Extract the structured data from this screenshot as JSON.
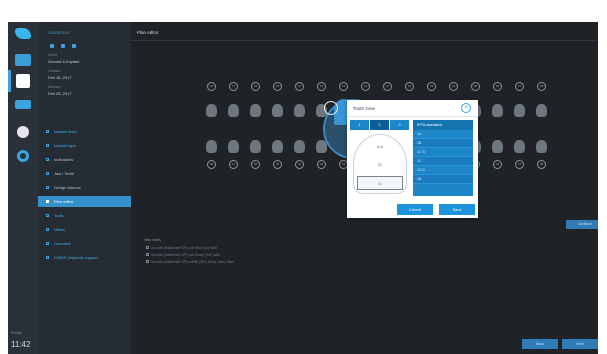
{
  "rail": {
    "clock_label": "Friday",
    "clock_time": "11:42"
  },
  "sidebar": {
    "header": "CLIENTELE",
    "small1": "Client",
    "line1": "Ground & Implant",
    "small2": "Created",
    "line2": "Feb 16, 2017",
    "small3": "Delivery",
    "line3": "Feb 28, 2017",
    "items": [
      {
        "label": "Implant level",
        "style": "blue"
      },
      {
        "label": "Implant type",
        "style": "blue"
      },
      {
        "label": "Indications",
        "style": "normal"
      },
      {
        "label": "Jaw / Teeth",
        "style": "normal"
      },
      {
        "label": "Design interval",
        "style": "normal"
      },
      {
        "label": "Plan editor",
        "style": "active"
      },
      {
        "label": "Tools",
        "style": "blue"
      },
      {
        "label": "Offset",
        "style": "blue"
      },
      {
        "label": "Overview",
        "style": "blue"
      },
      {
        "label": "SINCE (Implant) support",
        "style": "blue"
      }
    ]
  },
  "main": {
    "title": "Plan editor",
    "side_button": "Continue",
    "notes_title": "Help notes",
    "notes": [
      "Smooth (flatten/set SP) soft Slice (SI) Wall",
      "Smooth (flatten/set SP) soft Sharp (SH) Wall",
      "Smooth (flatten/set SP) soft/fill (SIF) Deep, Max) Wall"
    ],
    "upper_numbers": [
      "18",
      "17",
      "16",
      "15",
      "14",
      "13",
      "12",
      "11",
      "21",
      "22",
      "23",
      "24",
      "25",
      "26",
      "27",
      "28"
    ],
    "lower_numbers": [
      "48",
      "47",
      "46",
      "45",
      "44",
      "43",
      "42",
      "41",
      "31",
      "32",
      "33",
      "34",
      "35",
      "36",
      "37",
      "38"
    ],
    "bottom_back": "Back",
    "bottom_next": "Next"
  },
  "modal": {
    "title": "Tooth zone",
    "tabs": [
      "1",
      "2",
      "3"
    ],
    "zones": [
      "ICA",
      "ID",
      "IC"
    ],
    "panel_header": "IFFA standard",
    "panel_rows": [
      "1A",
      "1B",
      "1C S",
      "1C",
      "1C D",
      "1B"
    ],
    "cancel_label": "Cancel",
    "save_label": "Save"
  },
  "colors": {
    "accent": "#1d94dc",
    "background": "#1f2328",
    "sidebar": "#262c33"
  }
}
